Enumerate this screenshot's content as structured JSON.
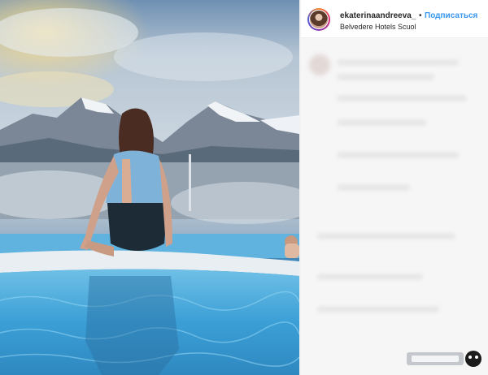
{
  "post": {
    "username": "ekaterinaandreeva_",
    "separator": "•",
    "follow_label": "Подписаться",
    "location": "Belvedere Hotels Scuol"
  },
  "icons": {
    "avatar": "profile-avatar",
    "watermark": "site-logo-watermark"
  },
  "colors": {
    "follow": "#3897f0",
    "text": "#262626"
  }
}
